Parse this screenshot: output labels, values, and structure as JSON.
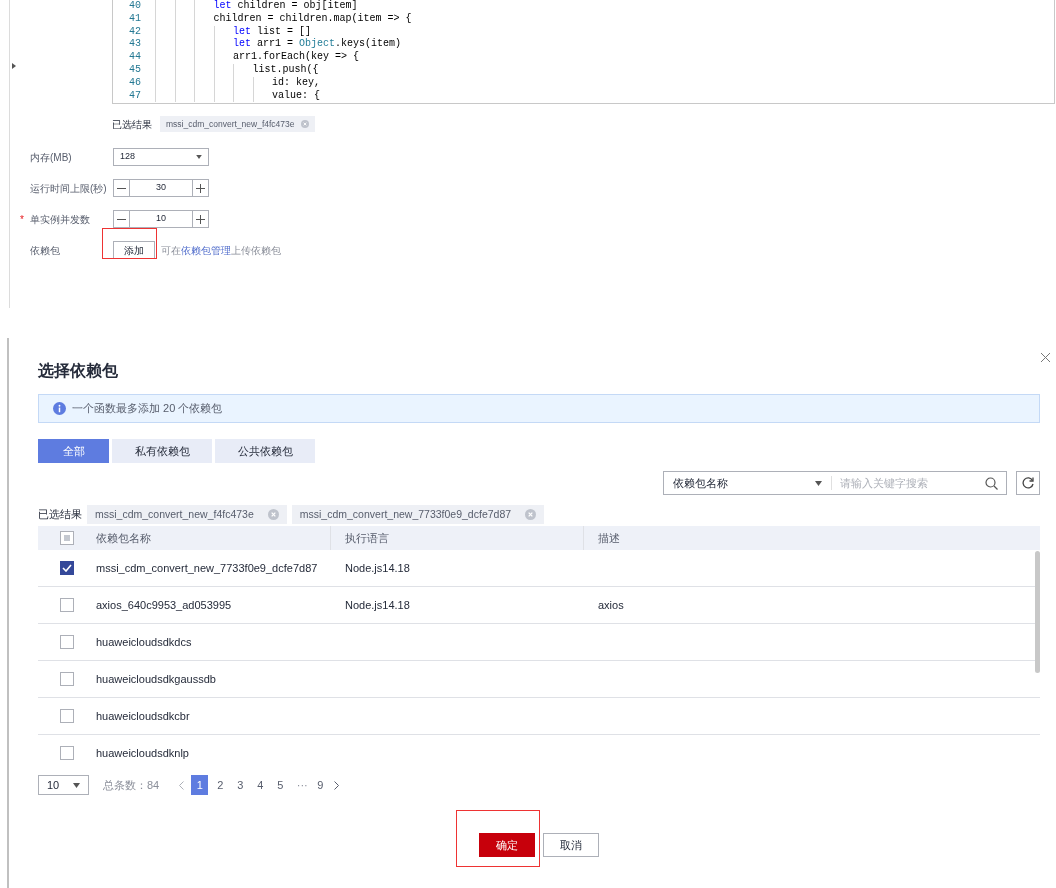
{
  "editor": {
    "lines": [
      {
        "number": "40",
        "tokens": [
          {
            "kind": "keyword",
            "text": "            let"
          },
          {
            "kind": "plain",
            "text": " children = obj[item]"
          }
        ]
      },
      {
        "number": "41",
        "tokens": [
          {
            "kind": "plain",
            "text": "            children = children.map(item => {"
          }
        ]
      },
      {
        "number": "42",
        "tokens": [
          {
            "kind": "keyword",
            "text": "                let"
          },
          {
            "kind": "plain",
            "text": " list = []"
          }
        ]
      },
      {
        "number": "43",
        "tokens": [
          {
            "kind": "keyword",
            "text": "                let"
          },
          {
            "kind": "plain",
            "text": " arr1 = "
          },
          {
            "kind": "class",
            "text": "Object"
          },
          {
            "kind": "plain",
            "text": ".keys(item)"
          }
        ]
      },
      {
        "number": "44",
        "tokens": [
          {
            "kind": "plain",
            "text": "                arr1.forEach(key => {"
          }
        ]
      },
      {
        "number": "45",
        "tokens": [
          {
            "kind": "plain",
            "text": "                    list.push({"
          }
        ]
      },
      {
        "number": "46",
        "tokens": [
          {
            "kind": "plain",
            "text": "                        id: key,"
          }
        ]
      },
      {
        "number": "47",
        "tokens": [
          {
            "kind": "plain",
            "text": "                        value: {"
          }
        ]
      }
    ]
  },
  "form": {
    "selected": {
      "label": "已选结果",
      "tags": [
        "mssi_cdm_convert_new_f4fc473e"
      ]
    },
    "fields": [
      {
        "kind": "select",
        "label": "内存(MB)",
        "value": "128"
      },
      {
        "kind": "stepper",
        "label": "运行时间上限(秒)",
        "value": "30"
      },
      {
        "kind": "stepper",
        "label": "单实例并发数",
        "required_mark": "*",
        "value": "10"
      },
      {
        "kind": "upload",
        "label": "依赖包",
        "button": "添加",
        "hint_before": "可在",
        "hint_link": "依赖包管理",
        "hint_after": "上传依赖包",
        "highlighted": true
      }
    ]
  },
  "dialog": {
    "title": "选择依赖包",
    "notice": "一个函数最多添加 20 个依赖包",
    "tabs": [
      {
        "label": "全部",
        "selected": true
      },
      {
        "label": "私有依赖包",
        "selected": false
      },
      {
        "label": "公共依赖包",
        "selected": false
      }
    ],
    "search": {
      "filter": "依赖包名称",
      "placeholder": "请输入关键字搜索"
    },
    "selected": {
      "label": "已选结果",
      "tags": [
        "mssi_cdm_convert_new_f4fc473e",
        "mssi_cdm_convert_new_7733f0e9_dcfe7d87"
      ]
    },
    "table": {
      "columns": [
        "依赖包名称",
        "执行语言",
        "描述"
      ],
      "header_partial": true,
      "rows": [
        {
          "checked": true,
          "name": "mssi_cdm_convert_new_7733f0e9_dcfe7d87",
          "runtime": "Node.js14.18",
          "description": ""
        },
        {
          "checked": false,
          "name": "axios_640c9953_ad053995",
          "runtime": "Node.js14.18",
          "description": "axios"
        },
        {
          "checked": false,
          "name": "huaweicloudsdkdcs",
          "runtime": "",
          "description": ""
        },
        {
          "checked": false,
          "name": "huaweicloudsdkgaussdb",
          "runtime": "",
          "description": ""
        },
        {
          "checked": false,
          "name": "huaweicloudsdkcbr",
          "runtime": "",
          "description": ""
        },
        {
          "checked": false,
          "name": "huaweicloudsdknlp",
          "runtime": "",
          "description": ""
        }
      ]
    },
    "pagination": {
      "page_size": "10",
      "total": "总条数：84",
      "pages": [
        {
          "kind": "page",
          "label": "1",
          "selected": true
        },
        {
          "kind": "page",
          "label": "2",
          "selected": false
        },
        {
          "kind": "page",
          "label": "3",
          "selected": false
        },
        {
          "kind": "page",
          "label": "4",
          "selected": false
        },
        {
          "kind": "page",
          "label": "5",
          "selected": false
        },
        {
          "kind": "ellipsis",
          "label": "···"
        },
        {
          "kind": "page",
          "label": "9",
          "selected": false
        }
      ]
    },
    "confirm": {
      "label": "确定",
      "highlighted": true
    },
    "cancel": {
      "label": "取消"
    }
  }
}
